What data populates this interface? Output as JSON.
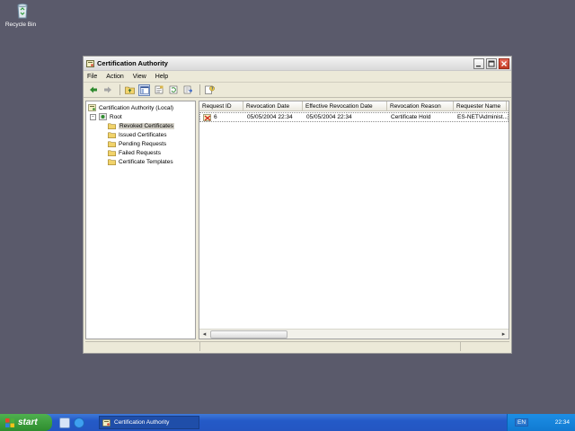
{
  "desktop": {
    "icons": [
      {
        "label": "Recycle Bin",
        "icon": "recycle-bin-icon"
      }
    ]
  },
  "window": {
    "title": "Certification Authority",
    "menu": [
      "File",
      "Action",
      "View",
      "Help"
    ],
    "toolbar_icons": [
      "back-arrow-icon",
      "forward-arrow-icon",
      "up-folder-icon",
      "show-hide-console-tree-icon",
      "properties-icon",
      "refresh-icon",
      "export-list-icon",
      "help-icon"
    ]
  },
  "tree": {
    "root_label": "Certification Authority (Local)",
    "ca_node": "Root",
    "items": [
      "Revoked Certificates",
      "Issued Certificates",
      "Pending Requests",
      "Failed Requests",
      "Certificate Templates"
    ],
    "selected": "Revoked Certificates"
  },
  "list": {
    "columns": [
      "Request ID",
      "Revocation Date",
      "Effective Revocation Date",
      "Revocation Reason",
      "Requester Name"
    ],
    "rows": [
      {
        "request_id": "6",
        "revocation_date": "05/05/2004 22:34",
        "effective_revocation_date": "05/05/2004 22:34",
        "revocation_reason": "Certificate Hold",
        "requester_name": "ES-NET\\Administ..."
      }
    ]
  },
  "taskbar": {
    "start_label": "start",
    "task_button": "Certification Authority",
    "language": "EN",
    "clock": "22:34"
  },
  "colors": {
    "desktop": "#5a5a6b",
    "taskbar": "#245ac7",
    "start_button": "#3a9c3a",
    "window_face": "#ece9d8"
  }
}
